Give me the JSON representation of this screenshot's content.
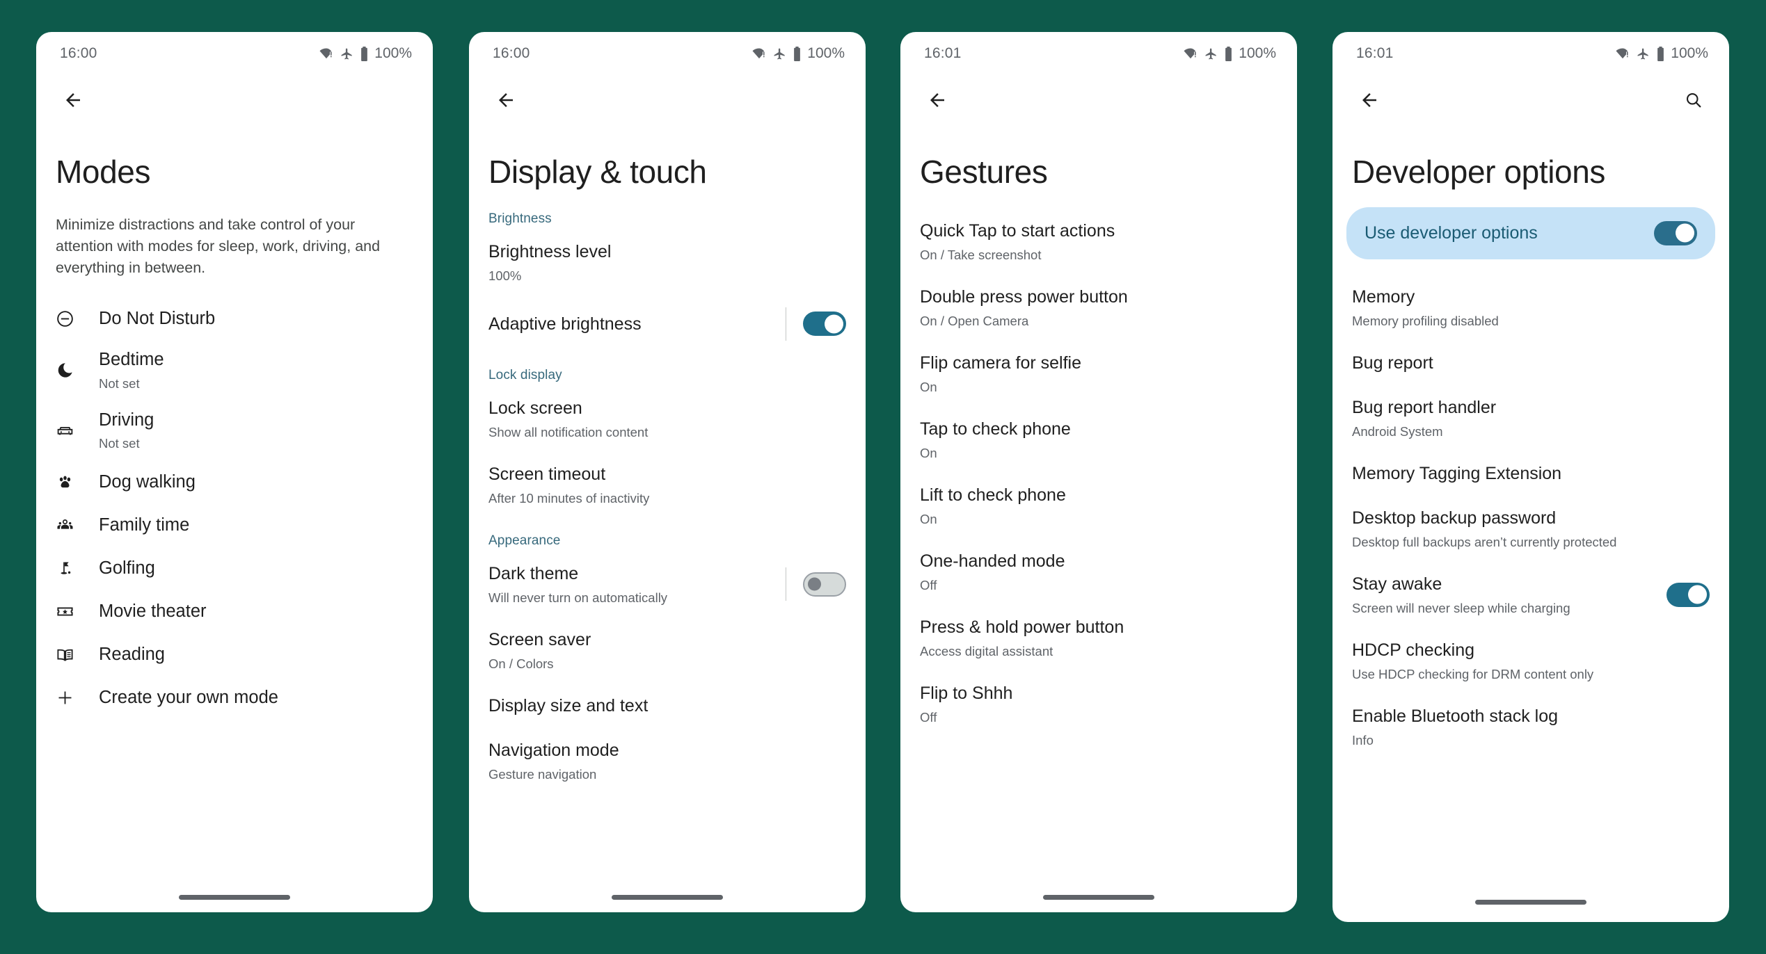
{
  "theme": {
    "background": "#0d5a4b",
    "accent_teal": "#37697c",
    "toggle_on": "#1f6f8b",
    "highlight_card_bg": "#c5e2f7",
    "highlight_card_text": "#1a5b73"
  },
  "panels": [
    {
      "status": {
        "time": "16:00",
        "battery": "100%",
        "icons": [
          "wifi-alert-icon",
          "airplane-mode-icon",
          "battery-full-icon"
        ]
      },
      "appbar": {
        "back": "back-arrow-icon",
        "action": null
      },
      "title": "Modes",
      "description": "Minimize distractions and take control of your attention with modes for sleep, work, driving, and everything in between.",
      "items": [
        {
          "icon": "do-not-disturb-icon",
          "title": "Do Not Disturb",
          "sub": ""
        },
        {
          "icon": "moon-icon",
          "title": "Bedtime",
          "sub": "Not set"
        },
        {
          "icon": "car-icon",
          "title": "Driving",
          "sub": "Not set"
        },
        {
          "icon": "paw-icon",
          "title": "Dog walking",
          "sub": ""
        },
        {
          "icon": "family-group-icon",
          "title": "Family time",
          "sub": ""
        },
        {
          "icon": "golf-flag-icon",
          "title": "Golfing",
          "sub": ""
        },
        {
          "icon": "movie-ticket-icon",
          "title": "Movie theater",
          "sub": ""
        },
        {
          "icon": "open-book-icon",
          "title": "Reading",
          "sub": ""
        },
        {
          "icon": "plus-icon",
          "title": "Create your own mode",
          "sub": ""
        }
      ]
    },
    {
      "status": {
        "time": "16:00",
        "battery": "100%",
        "icons": [
          "wifi-alert-icon",
          "airplane-mode-icon",
          "battery-full-icon"
        ]
      },
      "appbar": {
        "back": "back-arrow-icon",
        "action": null
      },
      "title": "Display & touch",
      "sections": [
        {
          "header": "Brightness",
          "rows": [
            {
              "title": "Brightness level",
              "sub": "100%",
              "toggle": null
            },
            {
              "title": "Adaptive brightness",
              "sub": "",
              "toggle": "on"
            }
          ]
        },
        {
          "header": "Lock display",
          "rows": [
            {
              "title": "Lock screen",
              "sub": "Show all notification content",
              "toggle": null
            },
            {
              "title": "Screen timeout",
              "sub": "After 10 minutes of inactivity",
              "toggle": null
            }
          ]
        },
        {
          "header": "Appearance",
          "rows": [
            {
              "title": "Dark theme",
              "sub": "Will never turn on automatically",
              "toggle": "off"
            },
            {
              "title": "Screen saver",
              "sub": "On / Colors",
              "toggle": null
            },
            {
              "title": "Display size and text",
              "sub": "",
              "toggle": null
            },
            {
              "title": "Navigation mode",
              "sub": "Gesture navigation",
              "toggle": null
            }
          ]
        }
      ]
    },
    {
      "status": {
        "time": "16:01",
        "battery": "100%",
        "icons": [
          "wifi-alert-icon",
          "airplane-mode-icon",
          "battery-full-icon"
        ]
      },
      "appbar": {
        "back": "back-arrow-icon",
        "action": null
      },
      "title": "Gestures",
      "rows": [
        {
          "title": "Quick Tap to start actions",
          "sub": "On / Take screenshot"
        },
        {
          "title": "Double press power button",
          "sub": "On / Open Camera"
        },
        {
          "title": "Flip camera for selfie",
          "sub": "On"
        },
        {
          "title": "Tap to check phone",
          "sub": "On"
        },
        {
          "title": "Lift to check phone",
          "sub": "On"
        },
        {
          "title": "One-handed mode",
          "sub": "Off"
        },
        {
          "title": "Press & hold power button",
          "sub": "Access digital assistant"
        },
        {
          "title": "Flip to Shhh",
          "sub": "Off"
        }
      ]
    },
    {
      "status": {
        "time": "16:01",
        "battery": "100%",
        "icons": [
          "wifi-alert-icon",
          "airplane-mode-icon",
          "battery-full-icon"
        ]
      },
      "appbar": {
        "back": "back-arrow-icon",
        "action": "search-icon"
      },
      "title": "Developer options",
      "highlight": {
        "label": "Use developer options",
        "toggle": "on"
      },
      "rows": [
        {
          "title": "Memory",
          "sub": "Memory profiling disabled",
          "toggle": null
        },
        {
          "title": "Bug report",
          "sub": "",
          "toggle": null
        },
        {
          "title": "Bug report handler",
          "sub": "Android System",
          "toggle": null
        },
        {
          "title": "Memory Tagging Extension",
          "sub": "",
          "toggle": null
        },
        {
          "title": "Desktop backup password",
          "sub": "Desktop full backups aren’t currently protected",
          "toggle": null
        },
        {
          "title": "Stay awake",
          "sub": "Screen will never sleep while charging",
          "toggle": "on"
        },
        {
          "title": "HDCP checking",
          "sub": "Use HDCP checking for DRM content only",
          "toggle": null
        },
        {
          "title": "Enable Bluetooth stack log",
          "sub": "Info",
          "toggle": null
        }
      ]
    }
  ]
}
